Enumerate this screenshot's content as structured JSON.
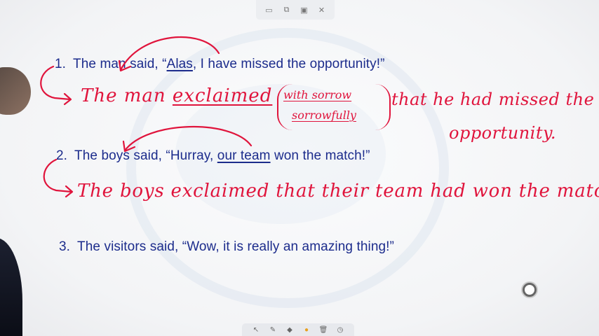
{
  "top_toolbar": {
    "buttons": [
      {
        "name": "minimize-icon",
        "glyph": "▭"
      },
      {
        "name": "copy-icon",
        "glyph": "⧉"
      },
      {
        "name": "save-icon",
        "glyph": "▣"
      },
      {
        "name": "close-icon",
        "glyph": "✕"
      }
    ]
  },
  "sentences": [
    {
      "num": "1.",
      "pre": "The man said, “",
      "underlined": "Alas",
      "post": ", I have missed the opportunity!”"
    },
    {
      "num": "2.",
      "pre": "The boys said, “Hurray, ",
      "underlined": "our team",
      "post": " won the match!”"
    },
    {
      "num": "3.",
      "pre": "The visitors said, “Wow, it is really an amazing thing!”",
      "underlined": "",
      "post": ""
    }
  ],
  "handwriting": {
    "line1_start": "The man",
    "line1_exclaimed": "exclaimed",
    "paren_top": "with sorrow",
    "paren_bottom": "sorrowfully",
    "line1_rest": "that he had missed the",
    "line1_end": "opportunity.",
    "line2": "The boys exclaimed that their team had won the match."
  },
  "colors": {
    "typed_text": "#1c2c8c",
    "ink": "#e0143c"
  },
  "bottom_toolbar": {
    "buttons": [
      {
        "name": "select-icon",
        "glyph": "↖"
      },
      {
        "name": "pen-icon",
        "glyph": "✎"
      },
      {
        "name": "eraser-icon",
        "glyph": "◆"
      },
      {
        "name": "color-icon",
        "glyph": "●"
      },
      {
        "name": "delete-icon",
        "glyph": "🗑"
      },
      {
        "name": "more-icon",
        "glyph": "◷"
      }
    ]
  }
}
